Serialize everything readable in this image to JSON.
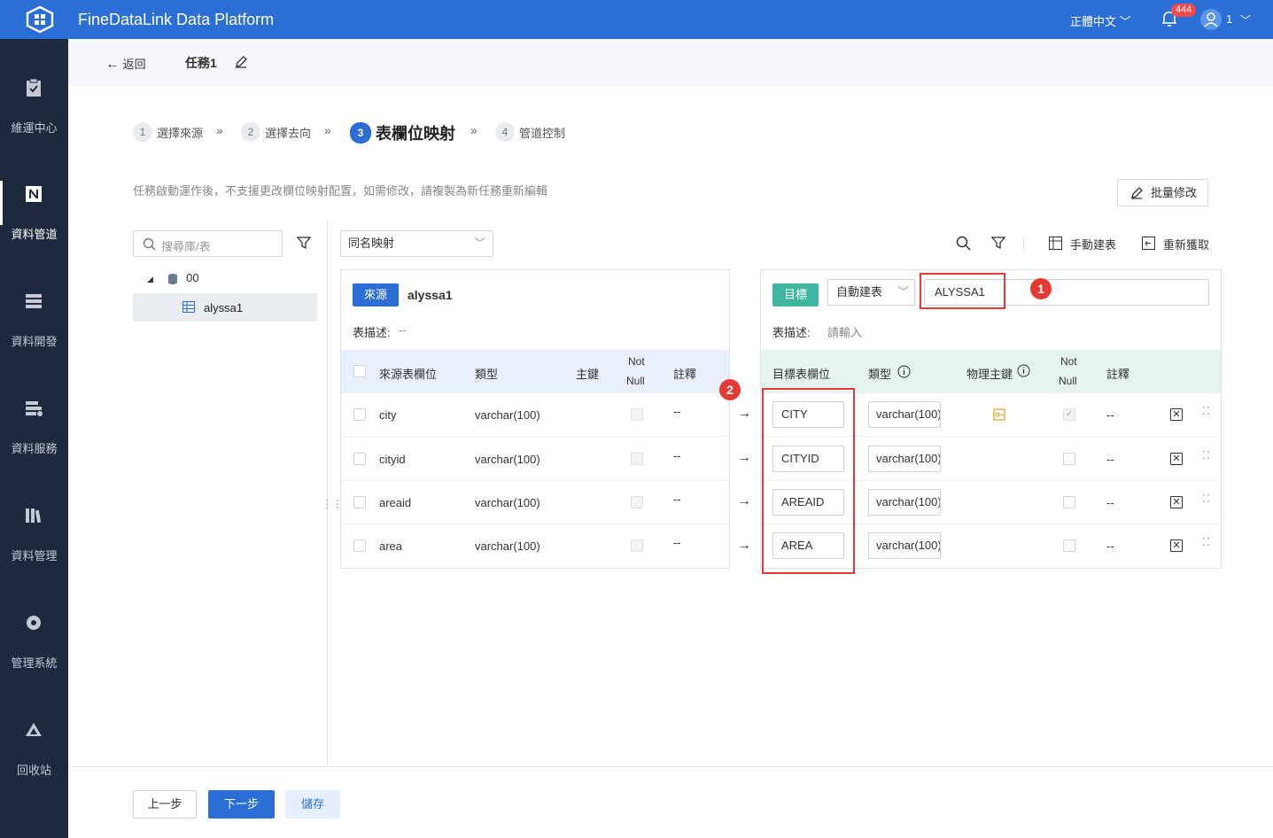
{
  "app": {
    "title": "FineDataLink Data Platform",
    "language": "正體中文",
    "notification_count": "444",
    "user": "1"
  },
  "sidebar": {
    "items": [
      {
        "label": "維運中心",
        "icon": "clipboard-check-icon"
      },
      {
        "label": "資料管道",
        "icon": "pipeline-icon",
        "active": true
      },
      {
        "label": "資料開發",
        "icon": "server-stack-icon"
      },
      {
        "label": "資料服務",
        "icon": "service-icon"
      },
      {
        "label": "資料管理",
        "icon": "bookshelf-icon"
      },
      {
        "label": "管理系統",
        "icon": "gear-icon"
      },
      {
        "label": "回收站",
        "icon": "recycle-icon"
      }
    ]
  },
  "header": {
    "back_label": "返回",
    "task_name": "任務1"
  },
  "steps": [
    {
      "num": "1",
      "label": "選擇來源"
    },
    {
      "num": "2",
      "label": "選擇去向"
    },
    {
      "num": "3",
      "label": "表欄位映射",
      "current": true
    },
    {
      "num": "4",
      "label": "管道控制"
    }
  ],
  "tip": "任務啟動運作後，不支援更改欄位映射配置，如需修改，請複製為新任務重新編輯",
  "batch_edit_label": "批量修改",
  "left": {
    "search_placeholder": "搜尋庫/表",
    "db_name": "00",
    "table_name": "alyssa1"
  },
  "toolbar": {
    "mapping_mode": "同名映射",
    "manual_create_label": "手動建表",
    "refresh_label": "重新獲取"
  },
  "source": {
    "tag": "來源",
    "table": "alyssa1",
    "desc_label": "表描述:",
    "desc_value": "--",
    "headers": {
      "field": "來源表欄位",
      "type": "類型",
      "pk": "主鍵",
      "notnull_1": "Not",
      "notnull_2": "Null",
      "comment": "註釋"
    },
    "rows": [
      {
        "field": "city",
        "type": "varchar(100)",
        "comment": "--"
      },
      {
        "field": "cityid",
        "type": "varchar(100)",
        "comment": "--"
      },
      {
        "field": "areaid",
        "type": "varchar(100)",
        "comment": "--"
      },
      {
        "field": "area",
        "type": "varchar(100)",
        "comment": "--"
      }
    ]
  },
  "target": {
    "tag": "目標",
    "create_mode": "自動建表",
    "table_name": "ALYSSA1",
    "desc_label": "表描述:",
    "desc_placeholder": "請輸入",
    "headers": {
      "field": "目標表欄位",
      "type": "類型",
      "pk": "物理主鍵",
      "notnull_1": "Not",
      "notnull_2": "Null",
      "comment": "註釋"
    },
    "rows": [
      {
        "field": "CITY",
        "type": "varchar(100)",
        "comment": "--",
        "pk": true,
        "notnull": true
      },
      {
        "field": "CITYID",
        "type": "varchar(100)",
        "comment": "--"
      },
      {
        "field": "AREAID",
        "type": "varchar(100)",
        "comment": "--"
      },
      {
        "field": "AREA",
        "type": "varchar(100)",
        "comment": "--"
      }
    ]
  },
  "annotations": {
    "marker_1": "1",
    "marker_2": "2"
  },
  "footer": {
    "prev_label": "上一步",
    "next_label": "下一步",
    "save_label": "儲存"
  },
  "colors": {
    "primary": "#2b6ed6",
    "teal": "#3fb6a0",
    "sidebar": "#1d2a3d",
    "highlight": "#e53935"
  }
}
